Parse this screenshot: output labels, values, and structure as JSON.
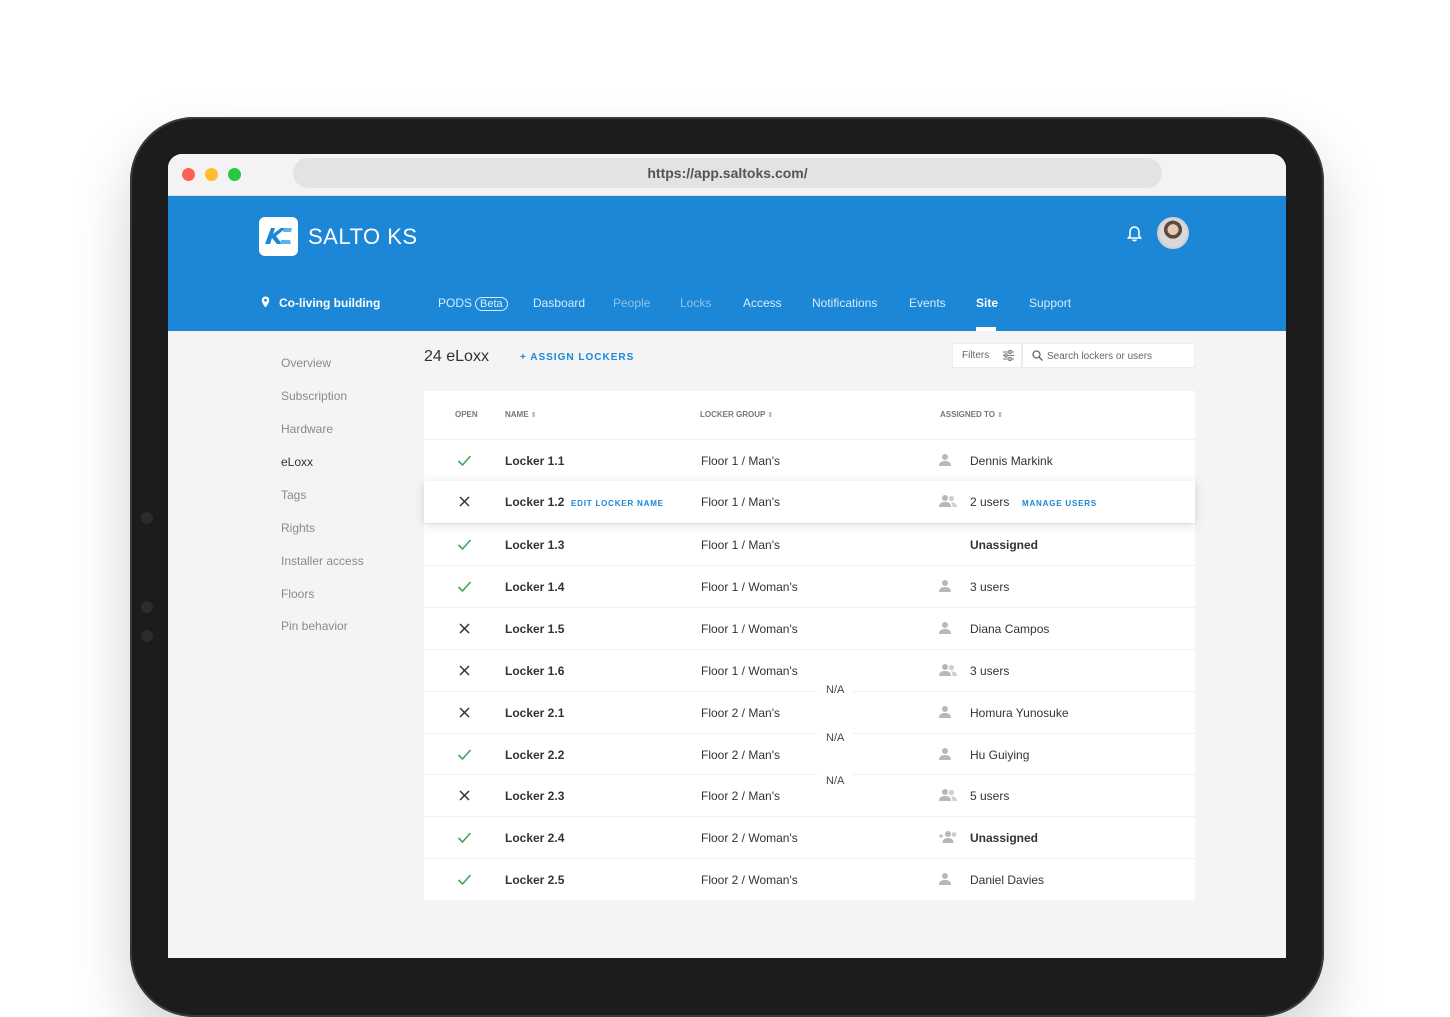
{
  "browser": {
    "url": "https://app.saltoks.com/"
  },
  "header": {
    "brand": "SALTO KS",
    "site": "Co-living building",
    "nav": [
      {
        "label": "PODS",
        "badge": "Beta"
      },
      {
        "label": "Dasboard"
      },
      {
        "label": "People"
      },
      {
        "label": "Locks"
      },
      {
        "label": "Access"
      },
      {
        "label": "Notifications"
      },
      {
        "label": "Events"
      },
      {
        "label": "Site"
      },
      {
        "label": "Support"
      }
    ]
  },
  "sidebar": {
    "items": [
      {
        "label": "Overview"
      },
      {
        "label": "Subscription"
      },
      {
        "label": "Hardware"
      },
      {
        "label": "eLoxx",
        "active": true
      },
      {
        "label": "Tags"
      },
      {
        "label": "Rights"
      },
      {
        "label": "Installer access"
      },
      {
        "label": "Floors"
      },
      {
        "label": "Pin behavior"
      }
    ]
  },
  "main": {
    "title": "24 eLoxx",
    "assign_label": "+ ASSIGN LOCKERS",
    "filters_label": "Filters",
    "search_placeholder": "Search lockers or users",
    "table": {
      "headers": {
        "open": "OPEN",
        "name": "NAME",
        "group": "LOCKER GROUP",
        "assigned": "ASSIGNED TO"
      },
      "edit_name_label": "EDIT LOCKER NAME",
      "manage_users_label": "MANAGE USERS",
      "rows": [
        {
          "open": true,
          "name": "Locker 1.1",
          "group": "Floor 1 / Man's",
          "assigned": "Dennis Markink",
          "icon": "user-icon"
        },
        {
          "open": false,
          "name": "Locker 1.2",
          "group": "Floor 1 / Man's",
          "assigned": "2 users",
          "icon": "users-icon"
        },
        {
          "open": true,
          "name": "Locker 1.3",
          "group": "Floor 1 / Man's",
          "assigned": "Unassigned",
          "icon": "none"
        },
        {
          "open": true,
          "name": "Locker 1.4",
          "group": "Floor 1 / Woman's",
          "assigned": "3 users",
          "icon": "user-icon"
        },
        {
          "open": false,
          "name": "Locker 1.5",
          "group": "Floor 1 / Woman's",
          "assigned": "Diana Campos",
          "icon": "user-icon"
        },
        {
          "open": false,
          "name": "Locker 1.6",
          "group": "Floor 1 / Woman's",
          "assigned": "3 users",
          "icon": "users-icon"
        },
        {
          "open": false,
          "name": "Locker 2.1",
          "group": "Floor 2 / Man's",
          "assigned": "Homura Yunosuke",
          "icon": "user-icon"
        },
        {
          "open": true,
          "name": "Locker 2.2",
          "group": "Floor 2 / Man's",
          "assigned": "Hu Guiying",
          "icon": "user-icon"
        },
        {
          "open": false,
          "name": "Locker 2.3",
          "group": "Floor 2 / Man's",
          "assigned": "5 users",
          "icon": "users-icon"
        },
        {
          "open": true,
          "name": "Locker 2.4",
          "group": "Floor 2 / Woman's",
          "assigned": "Unassigned",
          "icon": "add-user-icon"
        },
        {
          "open": true,
          "name": "Locker 2.5",
          "group": "Floor 2 / Woman's",
          "assigned": "Daniel Davies",
          "icon": "user-icon"
        }
      ],
      "na_labels": [
        "N/A",
        "N/A",
        "N/A"
      ]
    }
  },
  "colors": {
    "accent": "#1b87d6",
    "open": "#3fa75a",
    "closed": "#333333"
  }
}
